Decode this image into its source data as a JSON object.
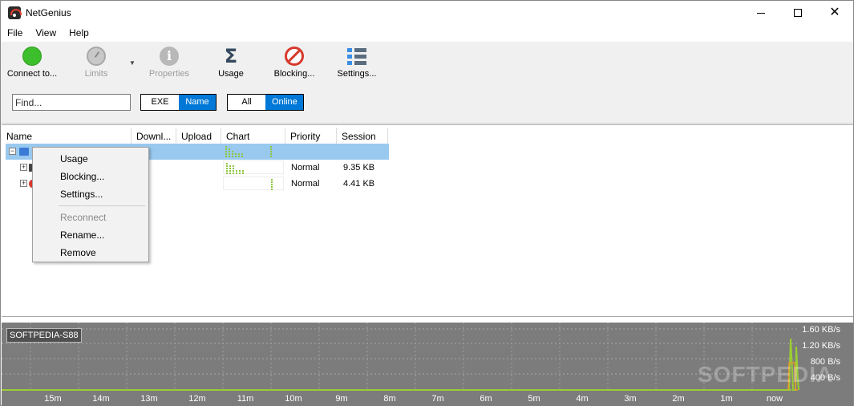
{
  "window": {
    "title": "NetGenius"
  },
  "menu": [
    "File",
    "View",
    "Help"
  ],
  "toolbar": {
    "connect": "Connect to...",
    "limits": "Limits",
    "properties": "Properties",
    "usage": "Usage",
    "blocking": "Blocking...",
    "settings": "Settings..."
  },
  "filters": {
    "find_placeholder": "Find...",
    "exe": "EXE",
    "name": "Name",
    "all": "All",
    "online": "Online"
  },
  "columns": [
    "Name",
    "Downl...",
    "Upload",
    "Chart",
    "Priority",
    "Session"
  ],
  "rows": [
    {
      "priority": "",
      "session": "",
      "selected": true,
      "bars": [
        5,
        4,
        3,
        2,
        2,
        2,
        0,
        0,
        0,
        0,
        0,
        0,
        0,
        0,
        5
      ]
    },
    {
      "priority": "Normal",
      "session": "9.35 KB",
      "selected": false,
      "bars": [
        5,
        4,
        4,
        2,
        2,
        2,
        0,
        0,
        0,
        0,
        0,
        0,
        0,
        0,
        0
      ]
    },
    {
      "priority": "Normal",
      "session": "4.41 KB",
      "selected": false,
      "bars": [
        0,
        0,
        0,
        0,
        0,
        0,
        0,
        0,
        0,
        0,
        0,
        0,
        0,
        0,
        5
      ]
    }
  ],
  "context_menu": {
    "usage": "Usage",
    "blocking": "Blocking...",
    "settings": "Settings...",
    "reconnect": "Reconnect",
    "rename": "Rename...",
    "remove": "Remove"
  },
  "graph": {
    "tag": "SOFTPEDIA-S88",
    "y_labels": [
      "1.60 KB/s",
      "1.20 KB/s",
      "800 B/s",
      "400 B/s"
    ],
    "x_labels": [
      "15m",
      "14m",
      "13m",
      "12m",
      "11m",
      "10m",
      "9m",
      "8m",
      "7m",
      "6m",
      "5m",
      "4m",
      "3m",
      "2m",
      "1m",
      "now"
    ],
    "watermark": "SOFTPEDIA",
    "colors": {
      "download": "#9acd32",
      "upload": "#e8962a",
      "background": "#7c7c7c"
    }
  }
}
